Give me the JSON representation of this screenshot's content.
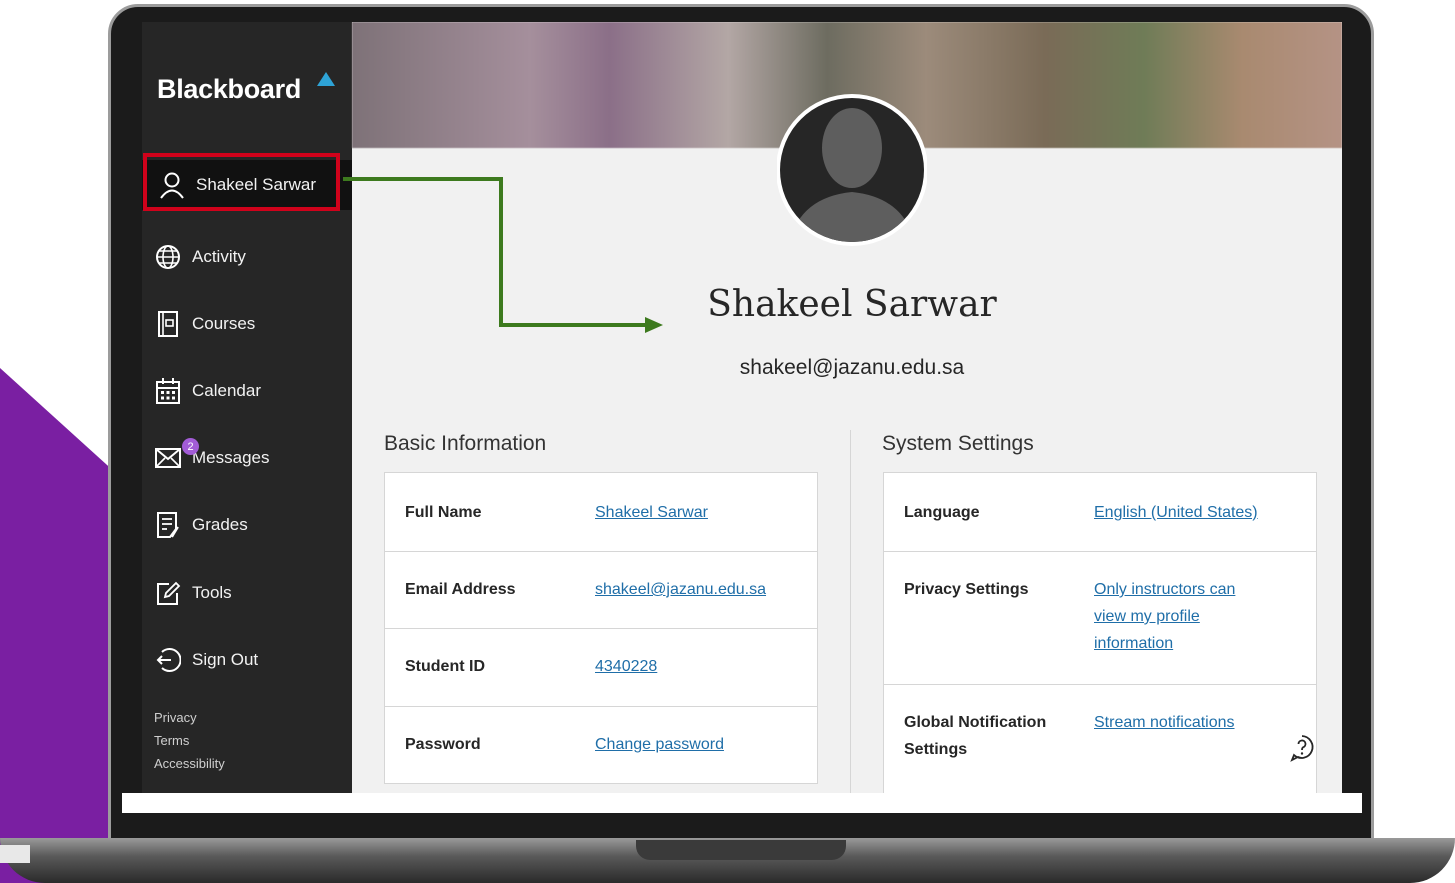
{
  "sidebar": {
    "logo": "Blackboard",
    "user_item": "Shakeel Sarwar",
    "items": [
      {
        "label": "Activity",
        "icon": "globe-icon"
      },
      {
        "label": "Courses",
        "icon": "courses-icon"
      },
      {
        "label": "Calendar",
        "icon": "calendar-icon"
      },
      {
        "label": "Messages",
        "icon": "envelope-icon",
        "badge": "2"
      },
      {
        "label": "Grades",
        "icon": "grades-icon"
      },
      {
        "label": "Tools",
        "icon": "tools-icon"
      },
      {
        "label": "Sign Out",
        "icon": "sign-out-icon"
      }
    ],
    "footer": [
      "Privacy",
      "Terms",
      "Accessibility"
    ]
  },
  "profile": {
    "name": "Shakeel Sarwar",
    "email": "shakeel@jazanu.edu.sa"
  },
  "basic_info": {
    "title": "Basic Information",
    "rows": [
      {
        "label": "Full Name",
        "value": "Shakeel Sarwar"
      },
      {
        "label": "Email Address",
        "value": "shakeel@jazanu.edu.sa"
      },
      {
        "label": "Student ID",
        "value": "4340228"
      },
      {
        "label": "Password",
        "value": "Change password"
      }
    ]
  },
  "system_settings": {
    "title": "System Settings",
    "rows": [
      {
        "label": "Language",
        "value": "English (United States)"
      },
      {
        "label": "Privacy Settings",
        "value_lines": [
          "Only instructors can",
          "view my profile",
          "information"
        ]
      },
      {
        "label_lines": [
          "Global Notification",
          "Settings"
        ],
        "value": "Stream notifications"
      }
    ]
  },
  "colors": {
    "accent_purple": "#7a1fa2",
    "highlight_red": "#d0021b",
    "arrow_green": "#3d7a1e",
    "link_blue": "#1f6ea8"
  }
}
